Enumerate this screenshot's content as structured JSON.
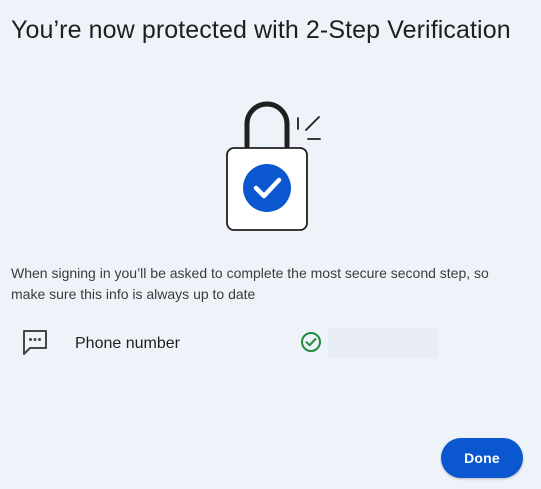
{
  "dialog": {
    "title": "You’re now protected with 2-Step Verification",
    "illustration_icon": "padlock-check-icon",
    "description": "When signing in you’ll be asked to complete the most secure second step, so make sure this info is always up to date"
  },
  "methods": [
    {
      "icon": "message-icon",
      "label": "Phone number",
      "status_icon": "check-circle-icon",
      "status_color": "#1e8e3e"
    }
  ],
  "actions": {
    "done_label": "Done"
  },
  "colors": {
    "accent": "#0b57d0",
    "background": "#eef2f9",
    "success": "#1e8e3e"
  }
}
